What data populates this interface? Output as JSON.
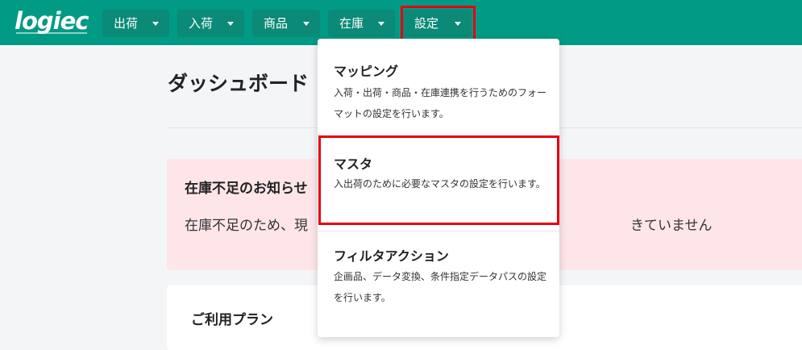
{
  "header": {
    "logo": "logiec",
    "nav": [
      {
        "label": "出荷"
      },
      {
        "label": "入荷"
      },
      {
        "label": "商品"
      },
      {
        "label": "在庫"
      },
      {
        "label": "設定"
      }
    ]
  },
  "main": {
    "title": "ダッシュボード",
    "alert": {
      "title": "在庫不足のお知らせ",
      "body_start": "在庫不足のため、現",
      "body_end": "きていません"
    },
    "plan": {
      "title": "ご利用プラン"
    }
  },
  "dropdown": {
    "items": [
      {
        "title": "マッピング",
        "desc": "入荷・出荷・商品・在庫連携を行うためのフォーマットの設定を行います。"
      },
      {
        "title": "マスタ",
        "desc": "入出荷のために必要なマスタの設定を行います。"
      },
      {
        "title": "フィルタアクション",
        "desc": "企画品、データ変換、条件指定データパスの設定を行います。"
      }
    ]
  },
  "colors": {
    "header_bg": "#009a85",
    "nav_btn_bg": "#0b8a77",
    "highlight": "#e60012",
    "alert_bg": "#fde5e8"
  }
}
